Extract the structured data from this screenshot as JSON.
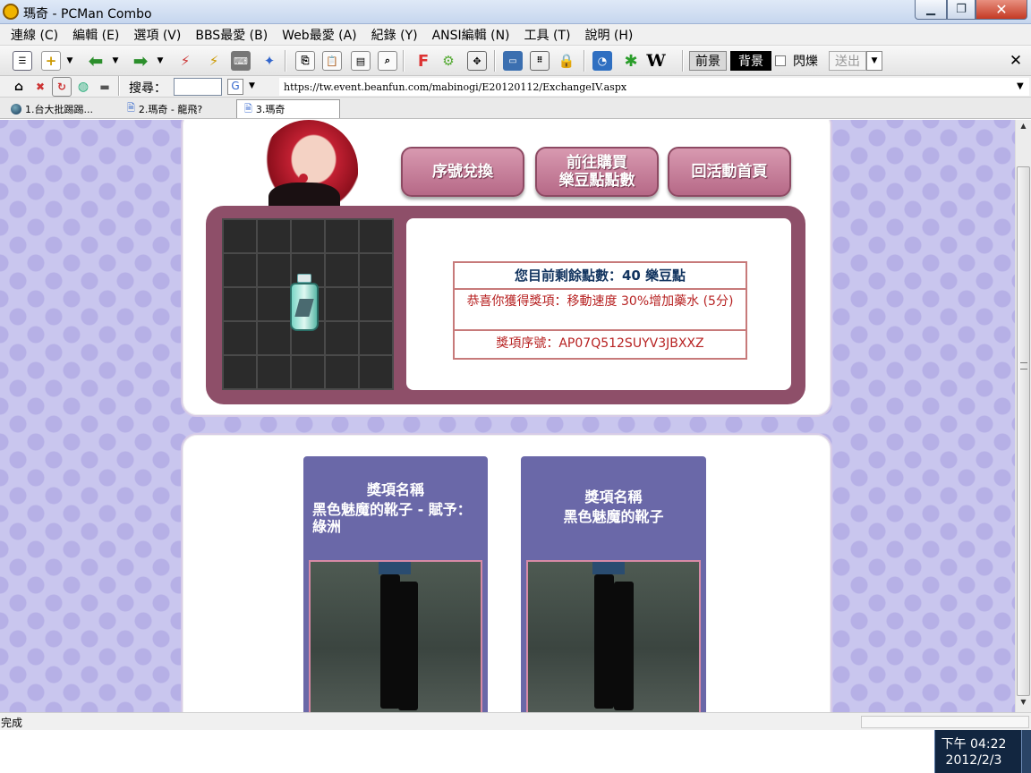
{
  "window": {
    "title": "瑪奇 - PCMan Combo"
  },
  "menu": [
    "連線 (C)",
    "編輯 (E)",
    "選項 (V)",
    "BBS最愛 (B)",
    "Web最愛 (A)",
    "紀錄 (Y)",
    "ANSI編輯 (N)",
    "工具 (T)",
    "說明 (H)"
  ],
  "toolbar": {
    "fg_label": "前景",
    "bg_label": "背景",
    "blink_label": "閃爍",
    "send_label": "送出"
  },
  "address": {
    "search_label": "搜尋：",
    "url": "https://tw.event.beanfun.com/mabinogi/E20120112/ExchangeIV.aspx"
  },
  "tabs": [
    {
      "label": "1.台大批踢踢..."
    },
    {
      "label": "2.瑪奇 - 龍飛?"
    },
    {
      "label": "3.瑪奇"
    }
  ],
  "page": {
    "nav": {
      "redeem": "序號兌換",
      "buy_line1": "前往購買",
      "buy_line2": "樂豆點點數",
      "home": "回活動首頁"
    },
    "result": {
      "points": "您目前剩餘點數：40 樂豆點",
      "prize": "恭喜你獲得獎項：移動速度 30%增加藥水 (5分)",
      "serial": "獎項序號：AP07Q512SUYV3JBXXZ"
    },
    "prizes": [
      {
        "heading": "獎項名稱",
        "name": "黑色魅魔的靴子 - 賦予：綠洲"
      },
      {
        "heading": "獎項名稱",
        "name": "黑色魅魔的靴子"
      }
    ]
  },
  "status": {
    "text": "完成"
  },
  "clock": {
    "time": "下午 04:22",
    "date": "2012/2/3"
  }
}
